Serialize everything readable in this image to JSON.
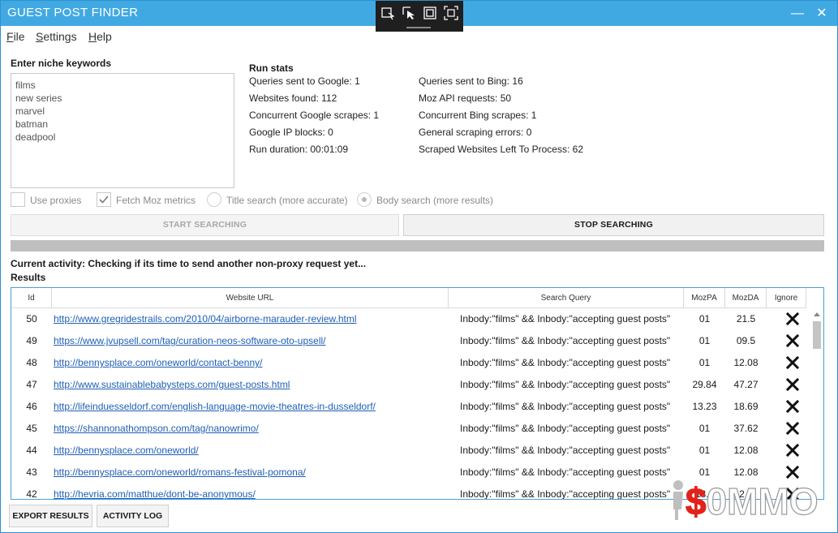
{
  "window": {
    "title": "GUEST POST FINDER"
  },
  "menu": {
    "file": {
      "accel": "F",
      "rest": "ile"
    },
    "settings": {
      "accel": "S",
      "rest": "ettings"
    },
    "help": {
      "accel": "H",
      "rest": "elp"
    }
  },
  "keywords": {
    "label": "Enter niche keywords",
    "lines": [
      "films",
      "new series",
      "marvel",
      "batman",
      "deadpool"
    ]
  },
  "stats": {
    "title": "Run stats",
    "left": [
      "Queries sent to Google: 1",
      "Websites found: 112",
      "Concurrent Google scrapes: 1",
      "Google IP blocks: 0",
      "Run duration: 00:01:09"
    ],
    "right": [
      "Queries sent to Bing: 16",
      "Moz API requests: 50",
      "Concurrent Bing scrapes: 1",
      "General scraping errors: 0",
      "Scraped Websites Left To Process: 62"
    ]
  },
  "options": {
    "use_proxies": {
      "label": "Use proxies",
      "checked": false
    },
    "fetch_moz": {
      "label": "Fetch Moz metrics",
      "checked": true
    },
    "title_search": {
      "label": "Title search (more accurate)",
      "selected": false
    },
    "body_search": {
      "label": "Body search (more results)",
      "selected": true
    }
  },
  "buttons": {
    "start": "START SEARCHING",
    "stop": "STOP SEARCHING",
    "export": "EXPORT RESULTS",
    "activity_log": "ACTIVITY LOG"
  },
  "activity": "Current activity: Checking if its time to send another non-proxy request yet...",
  "results": {
    "label": "Results",
    "columns": [
      "Id",
      "Website URL",
      "Search Query",
      "MozPA",
      "MozDA",
      "Ignore"
    ],
    "rows": [
      {
        "id": "50",
        "url": "http://www.gregridestrails.com/2010/04/airborne-marauder-review.html",
        "query": "Inbody:\"films\" && Inbody:\"accepting guest posts\"",
        "pa": "01",
        "da": "21.5"
      },
      {
        "id": "49",
        "url": "https://www.jvupsell.com/tag/curation-neos-software-oto-upsell/",
        "query": "Inbody:\"films\" && Inbody:\"accepting guest posts\"",
        "pa": "01",
        "da": "09.5"
      },
      {
        "id": "48",
        "url": "http://bennysplace.com/oneworld/contact-benny/",
        "query": "Inbody:\"films\" && Inbody:\"accepting guest posts\"",
        "pa": "01",
        "da": "12.08"
      },
      {
        "id": "47",
        "url": "http://www.sustainablebabysteps.com/guest-posts.html",
        "query": "Inbody:\"films\" && Inbody:\"accepting guest posts\"",
        "pa": "29.84",
        "da": "47.27"
      },
      {
        "id": "46",
        "url": "http://lifeinduesseldorf.com/english-language-movie-theatres-in-dusseldorf/",
        "query": "Inbody:\"films\" && Inbody:\"accepting guest posts\"",
        "pa": "13.23",
        "da": "18.69"
      },
      {
        "id": "45",
        "url": "https://shannonathompson.com/tag/nanowrimo/",
        "query": "Inbody:\"films\" && Inbody:\"accepting guest posts\"",
        "pa": "01",
        "da": "37.62"
      },
      {
        "id": "44",
        "url": "http://bennysplace.com/oneworld/",
        "query": "Inbody:\"films\" && Inbody:\"accepting guest posts\"",
        "pa": "01",
        "da": "12.08"
      },
      {
        "id": "43",
        "url": "http://bennysplace.com/oneworld/romans-festival-pomona/",
        "query": "Inbody:\"films\" && Inbody:\"accepting guest posts\"",
        "pa": "01",
        "da": "12.08"
      },
      {
        "id": "42",
        "url": "http://hevria.com/matthue/dont-be-anonymous/",
        "query": "Inbody:\"films\" && Inbody:\"accepting guest posts\"",
        "pa": "18.0",
        "da": "2.5"
      }
    ]
  },
  "watermark": {
    "text": "$0MMO"
  },
  "colors": {
    "titlebar": "#41a9e2",
    "link": "#1f5fb5",
    "grid_border": "#4b9fd8"
  }
}
